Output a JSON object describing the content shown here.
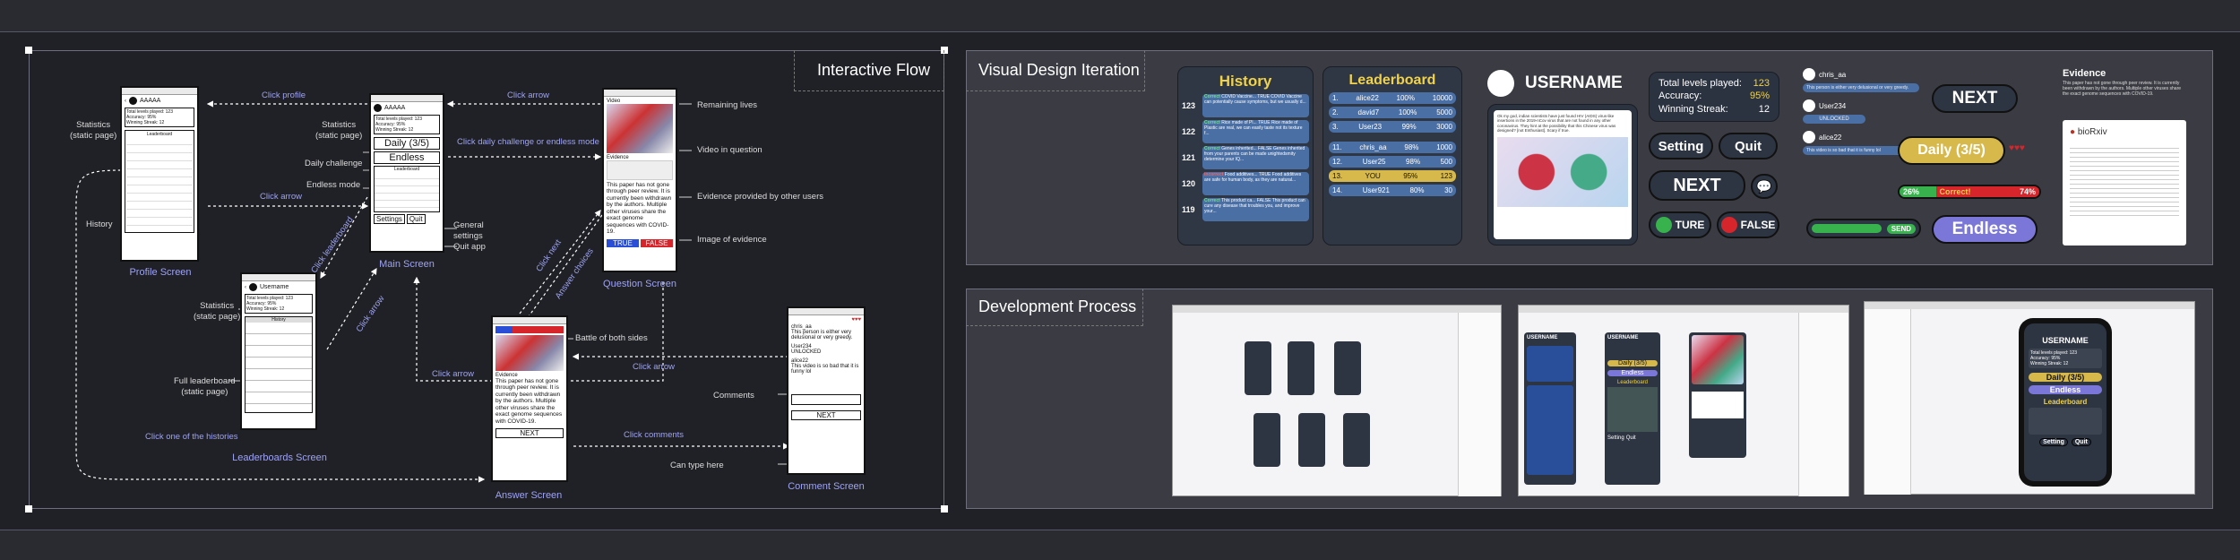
{
  "flow": {
    "title": "Interactive Flow",
    "screens": {
      "profile": "Profile Screen",
      "main": "Main Screen",
      "question": "Question Screen",
      "leaderboards": "Leaderboards Screen",
      "answer": "Answer Screen",
      "comment": "Comment Screen"
    },
    "labels": {
      "stats_static_1": "Statistics\n(static page)",
      "history": "History",
      "stats_static_2": "Statistics\n(static page)",
      "daily_challenge": "Daily challenge",
      "endless_mode": "Endless mode",
      "general_settings": "General\nsettings",
      "quit_app": "Quit app",
      "remaining_lives": "Remaining lives",
      "video_in_question": "Video in question",
      "evidence_by_users": "Evidence provided by other users",
      "image_of_evidence": "Image of evidence",
      "stats_static_3": "Statistics\n(static page)",
      "full_leaderboard": "Full leaderboard\n(static page)",
      "battle": "Battle of both sides",
      "comments": "Comments",
      "can_type": "Can type here"
    },
    "arrows": {
      "click_profile": "Click profile",
      "click_arrow_1": "Click arrow",
      "click_arrow_2": "Click arrow",
      "click_daily": "Click daily challenge or endless mode",
      "click_leaderboard": "Click leaderboard",
      "click_arrow_3": "Click arrow",
      "click_next": "Click next",
      "answer_choices": "Answer choices",
      "click_arrow_4": "Click arrow",
      "click_arrow_5": "Click arrow",
      "click_histories": "Click one of the histories",
      "click_comments": "Click comments"
    },
    "phone_text": {
      "username_short": "AAAAA",
      "username": "Username",
      "total_levels": "Total levels played: 123",
      "accuracy": "Accuracy: 95%",
      "winning_streak": "Winning Streak: 12",
      "leaderboard": "Leaderboard",
      "daily": "Daily (3/5)",
      "endless": "Endless",
      "settings": "Settings",
      "quit": "Quit",
      "history": "History",
      "video": "Video",
      "evidence": "Evidence",
      "evidence_text": "This paper has not gone through peer review. It is currently been withdrawn by the authors. Multiple other viruses share the exact genome sequences with COVID-19.",
      "true_btn": "TRUE",
      "false_btn": "FALSE",
      "next": "NEXT",
      "comment_1": "This person is either very delusional or very greedy.",
      "comment_2": "UNLOCKED",
      "comment_3": "This video is so bad that it is funny lol",
      "user_1": "chris_aa",
      "user_2": "User234",
      "user_3": "alice22"
    }
  },
  "visual": {
    "title": "Visual Design Iteration",
    "history_title": "History",
    "history_items": [
      {
        "num": "123",
        "status": "Correct",
        "text": "COVID Vaccine... TRUE COVID Vaccine can potentially cause symptoms, but we usually d..."
      },
      {
        "num": "122",
        "status": "Correct",
        "text": "Rice made of Pl... TRUE Rice made of Plastic are real, we can easily taste not its texture f..."
      },
      {
        "num": "121",
        "status": "Correct",
        "text": "Genes inherited... FALSE Genes inherited from your parents can be made unightedsmity determine your IQ..."
      },
      {
        "num": "120",
        "status": "Incorrect",
        "text": "Food additives... TRUE Food additives are safe for human body, as they are natural..."
      },
      {
        "num": "119",
        "status": "Correct",
        "text": "This product ca... FALSE This product can cure any disease that troubles you, and improve your..."
      }
    ],
    "leaderboard_title": "Leaderboard",
    "leaderboard_rows": [
      {
        "rank": "1.",
        "name": "alice22",
        "acc": "100%",
        "score": "10000"
      },
      {
        "rank": "2.",
        "name": "david7",
        "acc": "100%",
        "score": "5000"
      },
      {
        "rank": "3.",
        "name": "User23",
        "acc": "99%",
        "score": "3000"
      },
      {
        "rank": "11.",
        "name": "chris_aa",
        "acc": "98%",
        "score": "1000"
      },
      {
        "rank": "12.",
        "name": "User25",
        "acc": "98%",
        "score": "500"
      },
      {
        "rank": "13.",
        "name": "YOU",
        "acc": "95%",
        "score": "123"
      },
      {
        "rank": "14.",
        "name": "User921",
        "acc": "80%",
        "score": "30"
      }
    ],
    "username": "USERNAME",
    "video_caption": "Ok my god, indian scientists have just found HIV (AIDS) virus-like insertions in the 2019-nCov virus that are not found in any other coronavirus. They hint at the possibility that this Chinese virus was designed? [not Enthusiast]. Scary if true.",
    "stats": {
      "total_label": "Total levels played:",
      "total": "123",
      "acc_label": "Accuracy:",
      "acc": "95%",
      "streak_label": "Winning Streak:",
      "streak": "12"
    },
    "setting": "Setting",
    "quit": "Quit",
    "next": "NEXT",
    "ture": "TURE",
    "false": "FALSE",
    "comment_users": [
      "chris_aa",
      "User234",
      "alice22"
    ],
    "comment_texts": [
      "This person is either very delusional or very greedy.",
      "UNLOCKED",
      "This video is so bad that it is funny lol"
    ],
    "send": "SEND",
    "next2": "NEXT",
    "daily": "Daily (3/5)",
    "pct_left": "26%",
    "correct": "Correct!",
    "pct_right": "74%",
    "endless": "Endless",
    "evidence_title": "Evidence",
    "evidence_text": "This paper has not gone through peer review. It is currently been withdrawn by the authors. Multiple other viruses share the exact genome sequences with COVID-19.",
    "biorxiv": "bioRxiv"
  },
  "dev": {
    "title": "Development Process",
    "username": "USERNAME",
    "daily": "Daily (3/5)",
    "endless": "Endless",
    "leaderboard": "Leaderboard",
    "setting": "Setting",
    "quit": "Quit",
    "stats_total": "Total levels played: 123",
    "stats_acc": "Accuracy: 95%",
    "stats_streak": "Winning Streak: 12"
  },
  "colors": {
    "accent": "#9ea3f2",
    "red": "#d6262b",
    "blue": "#2a4fd6",
    "gold": "#d7b84a",
    "endless": "#7b77d9",
    "green": "#37b24d",
    "card": "#3c4452"
  }
}
